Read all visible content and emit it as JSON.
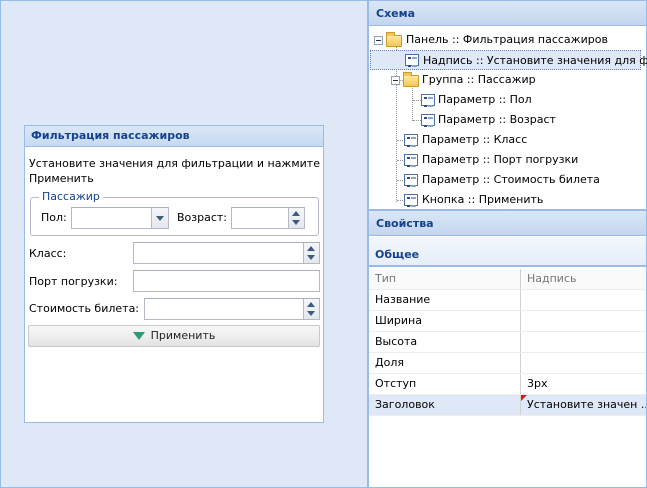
{
  "preview": {
    "panel_title": "Фильтрация пассажиров",
    "description": "Установите значения для фильтрации и нажмите Применить",
    "fieldset_legend": "Пассажир",
    "sex_label": "Пол:",
    "sex_value": "",
    "age_label": "Возраст:",
    "age_value": "",
    "class_label": "Класс:",
    "class_value": "",
    "port_label": "Порт погрузки:",
    "port_value": "",
    "cost_label": "Стоимость билета:",
    "cost_value": "",
    "apply_label": "Применить"
  },
  "schema": {
    "title": "Схема",
    "nodes": [
      {
        "label": "Панель :: Фильтрация пассажиров",
        "kind": "folder-icon"
      },
      {
        "label": "Надпись :: Установите значения для фи...",
        "kind": "field-icon"
      },
      {
        "label": "Группа :: Пассажир",
        "kind": "folder-icon"
      },
      {
        "label": "Параметр :: Пол",
        "kind": "field-icon"
      },
      {
        "label": "Параметр :: Возраст",
        "kind": "field-icon"
      },
      {
        "label": "Параметр :: Класс",
        "kind": "field-icon"
      },
      {
        "label": "Параметр :: Порт погрузки",
        "kind": "field-icon"
      },
      {
        "label": "Параметр :: Стоимость билета",
        "kind": "field-icon"
      },
      {
        "label": "Кнопка :: Применить",
        "kind": "field-icon"
      }
    ]
  },
  "properties": {
    "title": "Свойства",
    "group": "Общее",
    "rows": [
      {
        "key": "Тип",
        "value": "Надпись"
      },
      {
        "key": "Название",
        "value": ""
      },
      {
        "key": "Ширина",
        "value": ""
      },
      {
        "key": "Высота",
        "value": ""
      },
      {
        "key": "Доля",
        "value": ""
      },
      {
        "key": "Отступ",
        "value": "3px"
      },
      {
        "key": "Заголовок",
        "value": "Установите значен ..."
      }
    ]
  },
  "colors": {
    "accent": "#15428b",
    "border": "#99bbe8",
    "canvas": "#dfe8f6",
    "apply_icon": "#2f9a77",
    "dirty_marker": "#d11b1b"
  }
}
